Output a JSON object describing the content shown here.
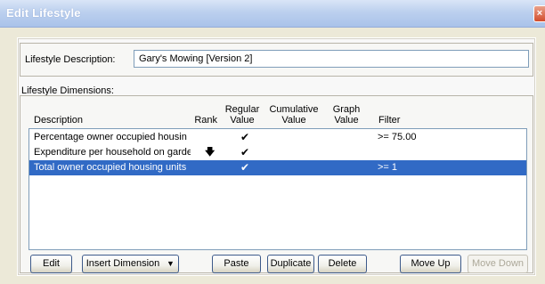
{
  "window": {
    "title": "Edit Lifestyle",
    "close_glyph": "×"
  },
  "description": {
    "label": "Lifestyle Description:",
    "value": "Gary's Mowing [Version 2]"
  },
  "dimensions": {
    "label": "Lifestyle Dimensions:",
    "headers": {
      "description": "Description",
      "rank": "Rank",
      "regular_value": "Regular\nValue",
      "cumulative_value": "Cumulative\nValue",
      "graph_value": "Graph\nValue",
      "filter": "Filter"
    },
    "rows": [
      {
        "description": "Percentage owner occupied housin",
        "rank": "",
        "regular": "✔",
        "filter": ">= 75.00",
        "selected": false
      },
      {
        "description": "Expenditure per household on gardе",
        "rank": "🡇",
        "regular": "✔",
        "filter": "",
        "selected": false
      },
      {
        "description": "Total owner occupied housing units",
        "rank": "",
        "regular": "✔",
        "filter": ">= 1",
        "selected": true
      }
    ]
  },
  "buttons": {
    "edit": "Edit",
    "insert_dimension": "Insert Dimension",
    "insert_arrow": "▼",
    "paste": "Paste",
    "duplicate": "Duplicate",
    "delete": "Delete",
    "move_up": "Move Up",
    "move_down": "Move Down"
  }
}
